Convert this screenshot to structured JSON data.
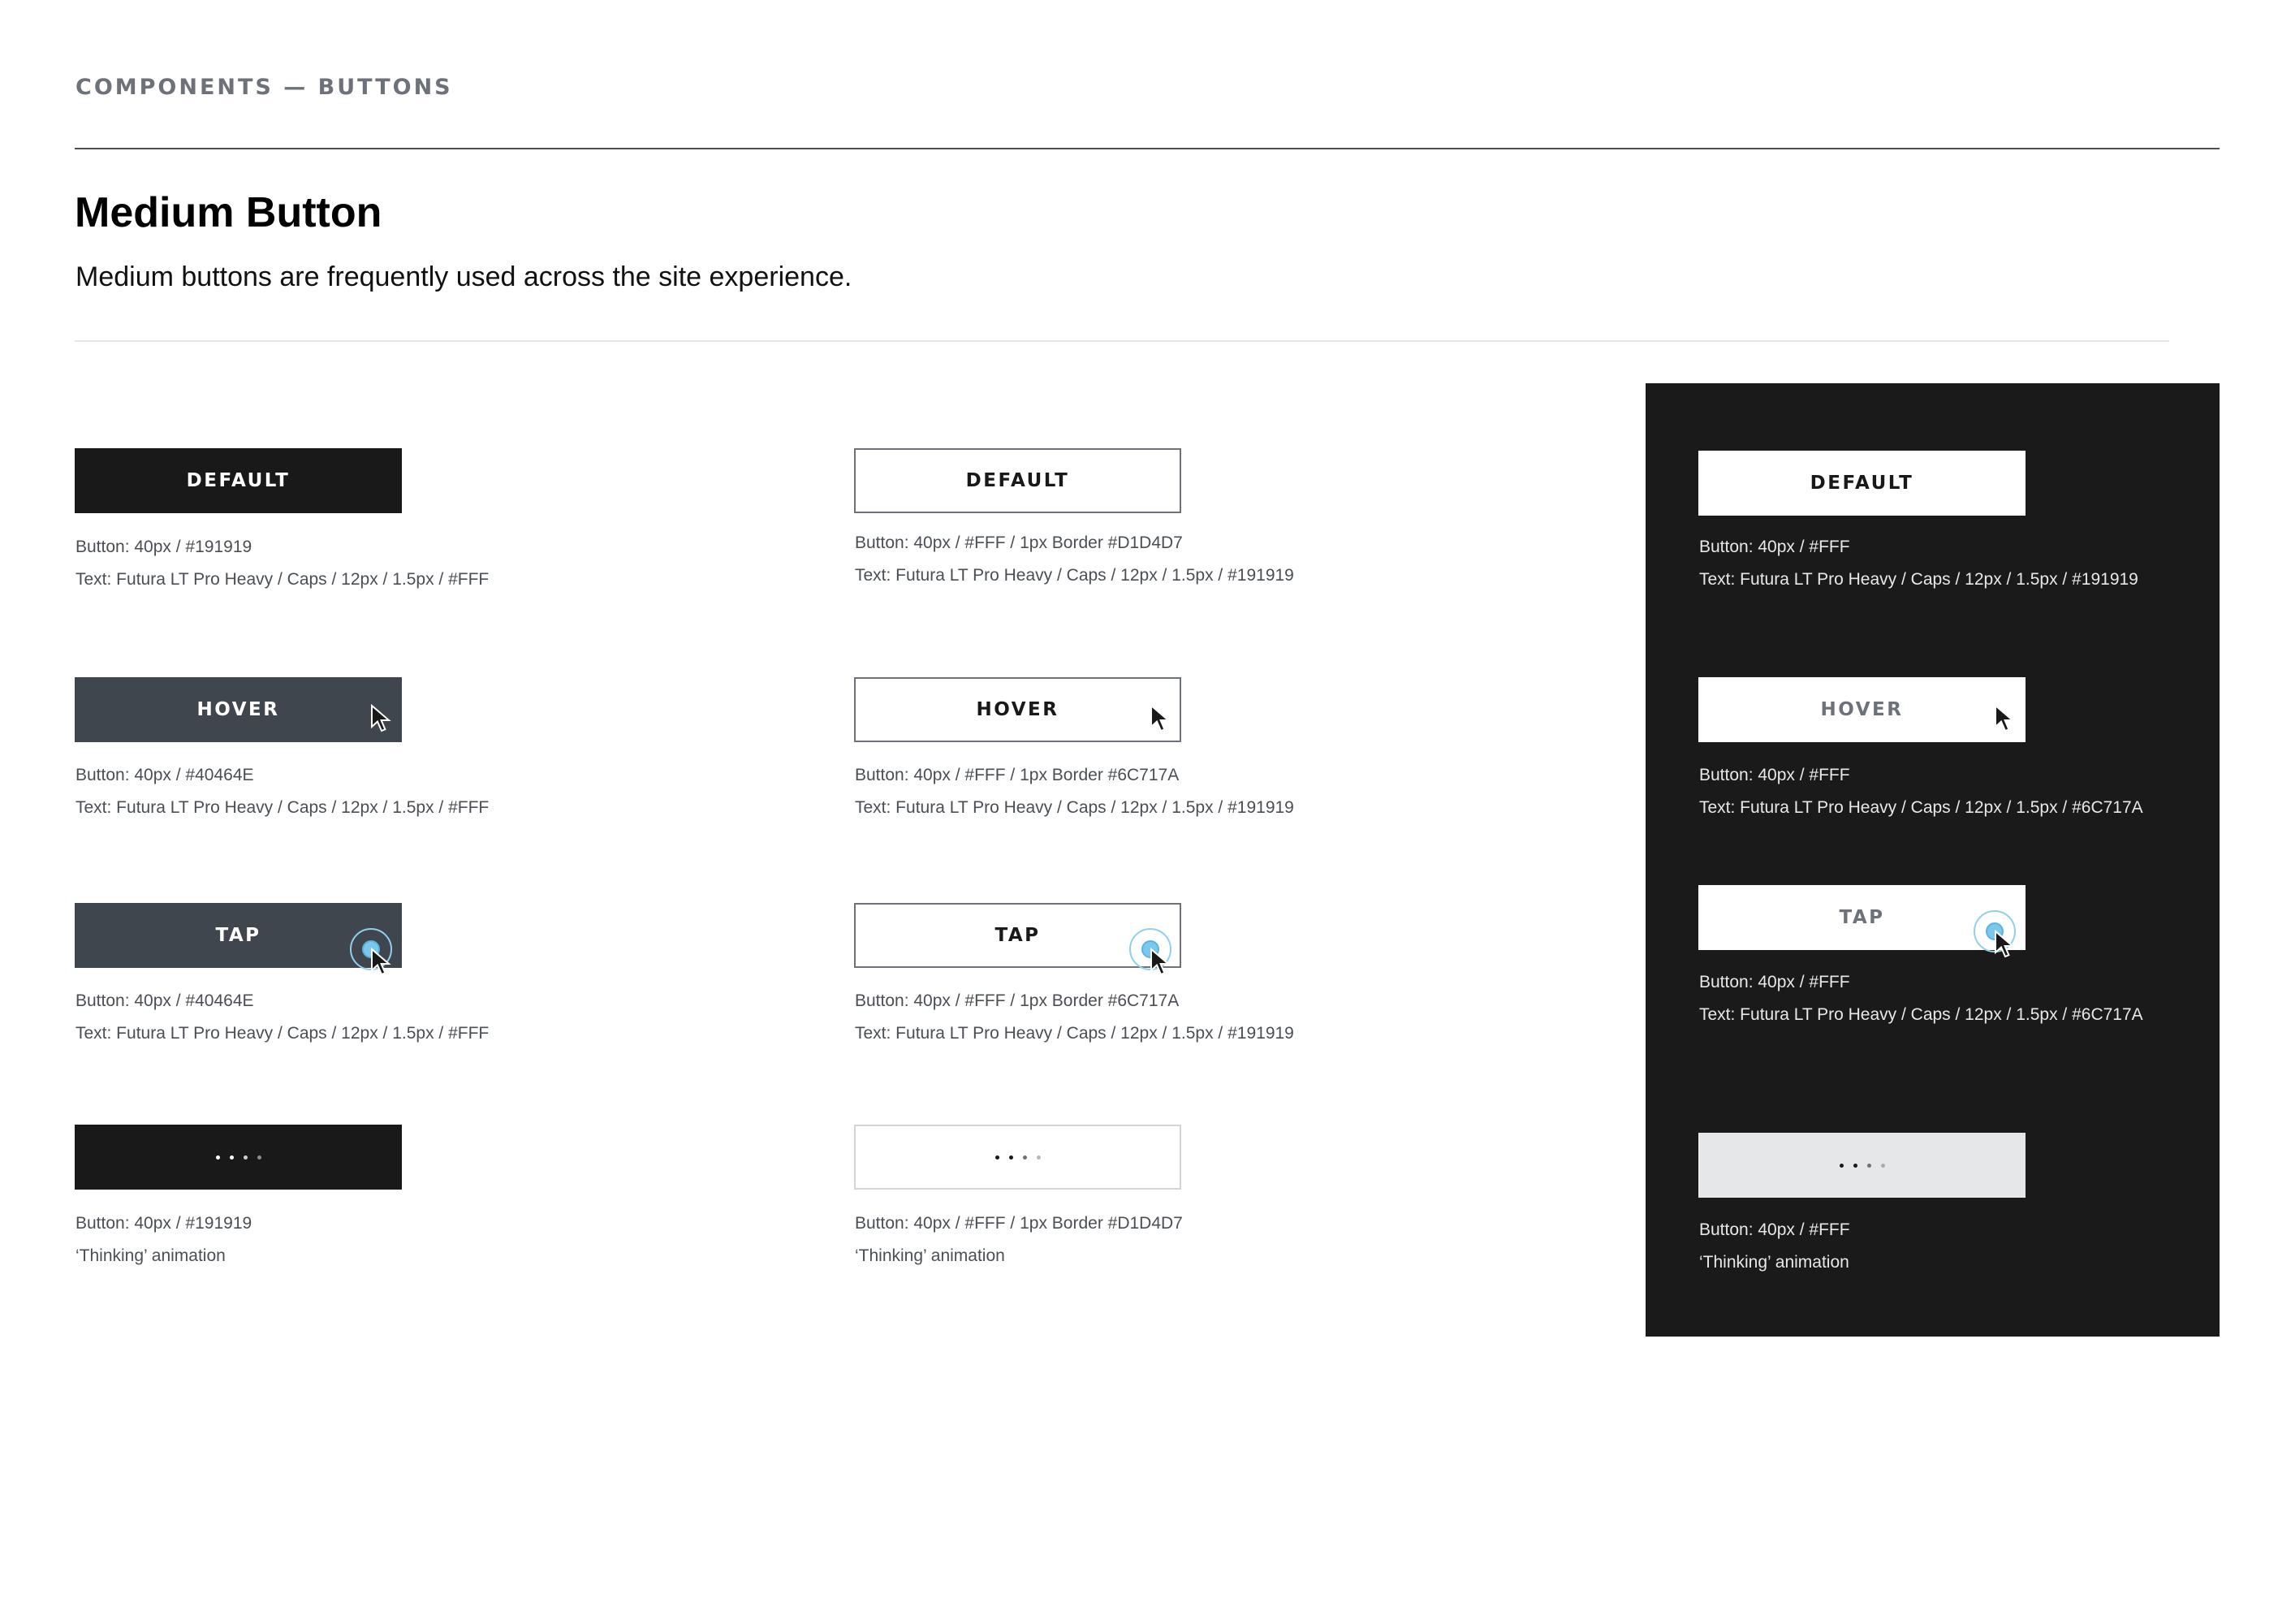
{
  "header": {
    "eyebrow": "COMPONENTS — BUTTONS",
    "title": "Medium Button",
    "description": "Medium buttons are frequently used across the site experience."
  },
  "colors": {
    "primary": "#191919",
    "hover_gray": "#40464E",
    "border_light": "#D1D4D7",
    "muted": "#6C717A",
    "white": "#FFF",
    "dark_panel": "#1A1A1A",
    "loading_bg": "#E6E7E9",
    "tap_ripple": "#7CC8EC"
  },
  "columns": {
    "solid": {
      "default": {
        "label": "DEFAULT",
        "spec_line1": "Button: 40px / #191919",
        "spec_line2": "Text: Futura LT Pro Heavy / Caps / 12px / 1.5px / #FFF"
      },
      "hover": {
        "label": "HOVER",
        "spec_line1": "Button: 40px / #40464E",
        "spec_line2": "Text: Futura LT Pro Heavy / Caps / 12px / 1.5px / #FFF"
      },
      "tap": {
        "label": "TAP",
        "spec_line1": "Button: 40px / #40464E",
        "spec_line2": "Text: Futura LT Pro Heavy / Caps / 12px / 1.5px / #FFF"
      },
      "thinking": {
        "spec_line1": "Button: 40px / #191919",
        "spec_line2": "‘Thinking’  animation"
      }
    },
    "outline": {
      "default": {
        "label": "DEFAULT",
        "spec_line1": "Button: 40px / #FFF / 1px Border #D1D4D7",
        "spec_line2": "Text: Futura LT Pro Heavy / Caps / 12px / 1.5px / #191919"
      },
      "hover": {
        "label": "HOVER",
        "spec_line1": "Button: 40px / #FFF / 1px Border #6C717A",
        "spec_line2": "Text: Futura LT Pro Heavy / Caps / 12px / 1.5px / #191919"
      },
      "tap": {
        "label": "TAP",
        "spec_line1": "Button: 40px / #FFF / 1px Border #6C717A",
        "spec_line2": "Text: Futura LT Pro Heavy / Caps / 12px / 1.5px / #191919"
      },
      "thinking": {
        "spec_line1": "Button: 40px / #FFF / 1px Border #D1D4D7",
        "spec_line2": "‘Thinking’  animation"
      }
    },
    "inverse": {
      "default": {
        "label": "DEFAULT",
        "spec_line1": "Button: 40px / #FFF",
        "spec_line2": "Text: Futura LT Pro Heavy / Caps / 12px / 1.5px / #191919"
      },
      "hover": {
        "label": "HOVER",
        "spec_line1": "Button: 40px / #FFF",
        "spec_line2": "Text: Futura LT Pro Heavy / Caps / 12px / 1.5px / #6C717A"
      },
      "tap": {
        "label": "TAP",
        "spec_line1": "Button: 40px / #FFF",
        "spec_line2": "Text: Futura LT Pro Heavy / Caps / 12px / 1.5px / #6C717A"
      },
      "thinking": {
        "spec_line1": "Button: 40px / #FFF",
        "spec_line2": "‘Thinking’  animation"
      }
    }
  }
}
